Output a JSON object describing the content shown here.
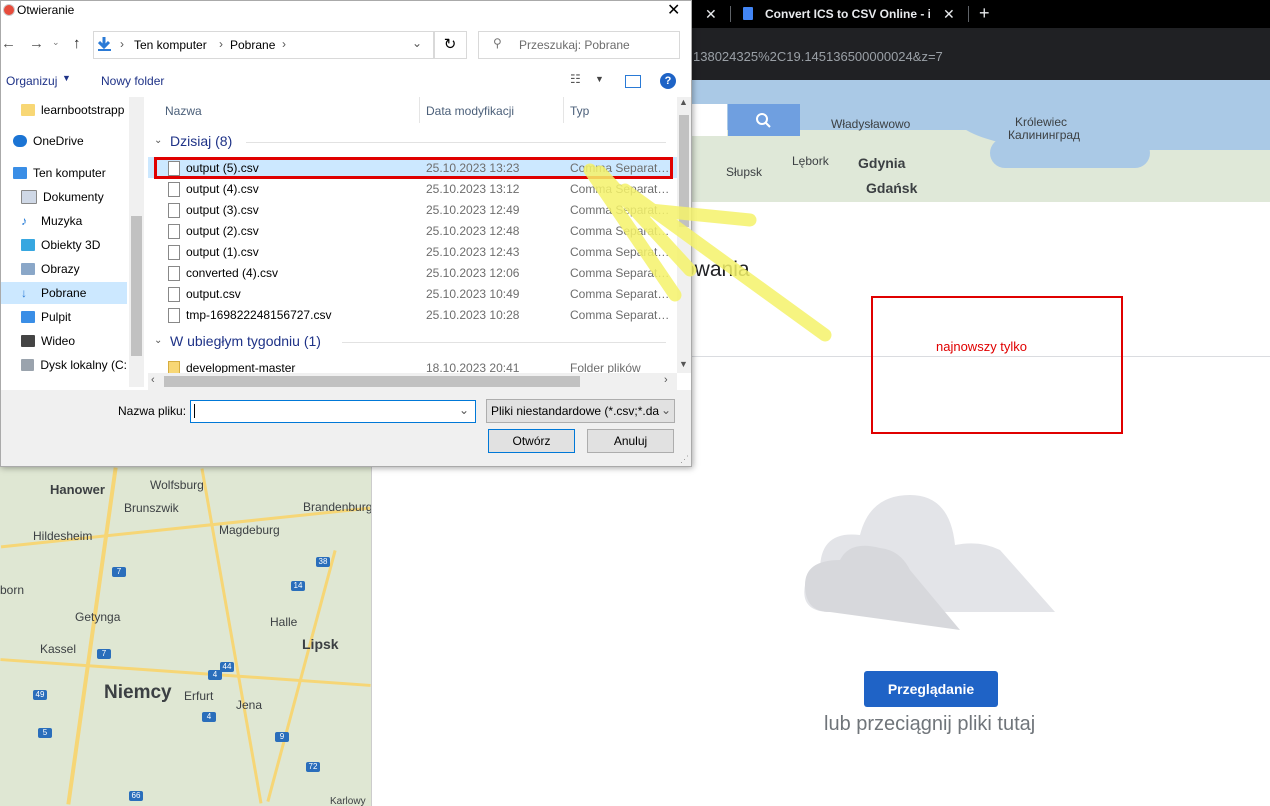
{
  "browser": {
    "tabs": [
      {
        "title": ""
      },
      {
        "title": "Convert ICS to CSV Online - iC"
      }
    ],
    "new_tab_glyph": "+",
    "close_glyph": "✕",
    "url_fragment": "138024325%2C19.145136500000024&z=7"
  },
  "map_top": {
    "cities": [
      "Władysławowo",
      "Królewiec",
      "Калининград",
      "Gdynia",
      "Gdańsk",
      "Lębork",
      "Słupsk"
    ]
  },
  "map_left": {
    "cities": [
      "Hanower",
      "Wolfsburg",
      "Brunszwik",
      "Brandenburg",
      "Hildesheim",
      "Magdeburg",
      "born",
      "Getynga",
      "Halle",
      "Lipsk",
      "Kassel",
      "Niemcy",
      "Erfurt",
      "Jena",
      "Karlowy"
    ],
    "shields": [
      "7",
      "7",
      "49",
      "4",
      "9",
      "72",
      "38",
      "14",
      "44",
      "4",
      "5",
      "66"
    ]
  },
  "page": {
    "heading_fragment": "owania",
    "annotation": "najnowszy tylko",
    "upload_button": "Przeglądanie",
    "drop_text": "lub przeciągnij pliki tutaj"
  },
  "dialog": {
    "title": "Otwieranie",
    "close": "✕",
    "path": [
      "Ten komputer",
      "Pobrane"
    ],
    "search_placeholder": "Przeszukaj: Pobrane",
    "toolbar": {
      "organize": "Organizuj",
      "new_folder": "Nowy folder"
    },
    "nav_items": [
      "learnbootstrapp",
      "OneDrive",
      "Ten komputer",
      "Dokumenty",
      "Muzyka",
      "Obiekty 3D",
      "Obrazy",
      "Pobrane",
      "Pulpit",
      "Wideo",
      "Dysk lokalny (C:"
    ],
    "columns": {
      "name": "Nazwa",
      "date": "Data modyfikacji",
      "type": "Typ"
    },
    "groups": [
      {
        "label": "Dzisiaj (8)",
        "files": [
          {
            "name": "output (5).csv",
            "date": "25.10.2023 13:23",
            "type": "Comma Separated"
          },
          {
            "name": "output (4).csv",
            "date": "25.10.2023 13:12",
            "type": "Comma Separated"
          },
          {
            "name": "output (3).csv",
            "date": "25.10.2023 12:49",
            "type": "Comma Separated"
          },
          {
            "name": "output (2).csv",
            "date": "25.10.2023 12:48",
            "type": "Comma Separated"
          },
          {
            "name": "output (1).csv",
            "date": "25.10.2023 12:43",
            "type": "Comma Separated"
          },
          {
            "name": "converted (4).csv",
            "date": "25.10.2023 12:06",
            "type": "Comma Separated"
          },
          {
            "name": "output.csv",
            "date": "25.10.2023 10:49",
            "type": "Comma Separated"
          },
          {
            "name": "tmp-169822248156727.csv",
            "date": "25.10.2023 10:28",
            "type": "Comma Separated"
          }
        ]
      },
      {
        "label": "W ubiegłym tygodniu (1)",
        "files": [
          {
            "name": "development-master",
            "date": "18.10.2023 20:41",
            "type": "Folder plików"
          }
        ]
      }
    ],
    "filename_label": "Nazwa pliku:",
    "filename_value": "",
    "filter_value": "Pliki niestandardowe (*.csv;*.da",
    "open_button": "Otwórz",
    "cancel_button": "Anuluj"
  },
  "colors": {
    "annotation_red": "#e00000",
    "highlighter": "#f5f26a",
    "primary_blue": "#1f63c6"
  }
}
